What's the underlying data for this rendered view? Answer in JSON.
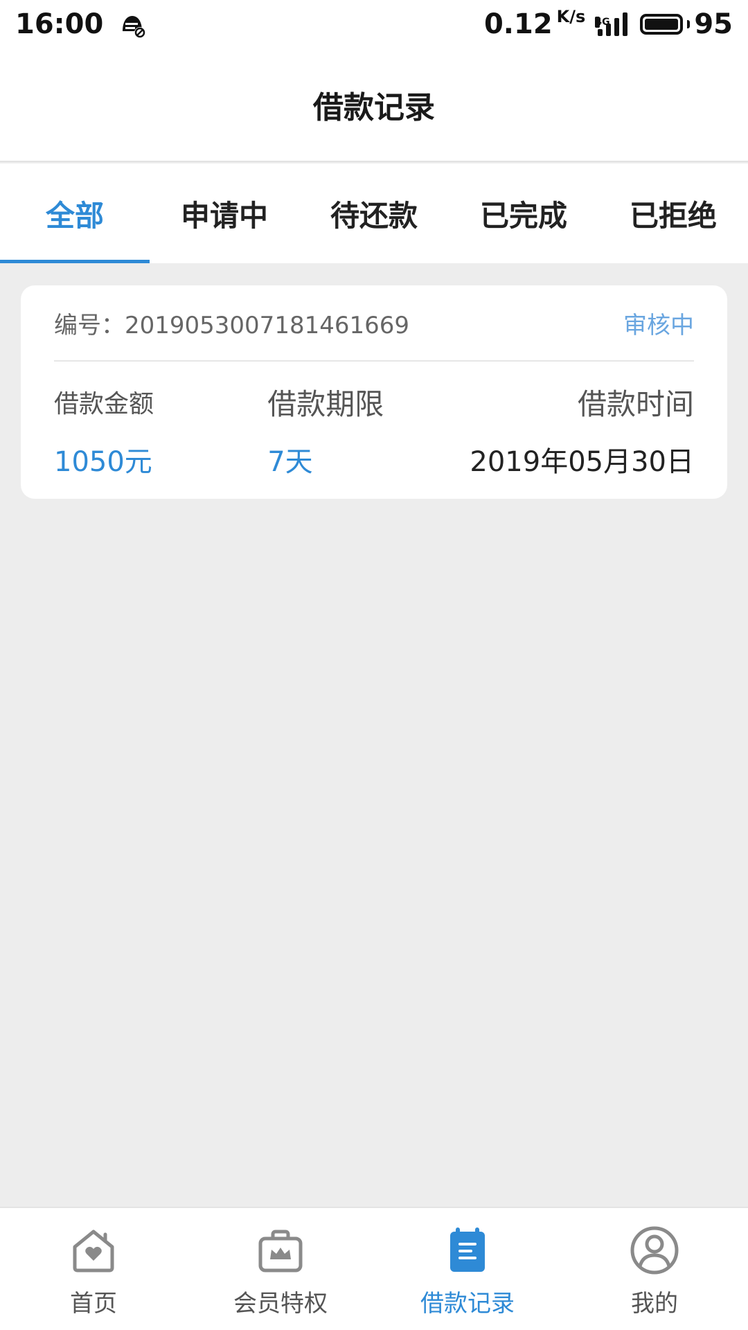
{
  "status_bar": {
    "time": "16:00",
    "speed": "0.12",
    "speed_unit": "K/s",
    "network": "4G",
    "battery": "95"
  },
  "header": {
    "title": "借款记录"
  },
  "tabs": [
    {
      "label": "全部",
      "active": true
    },
    {
      "label": "申请中",
      "active": false
    },
    {
      "label": "待还款",
      "active": false
    },
    {
      "label": "已完成",
      "active": false
    },
    {
      "label": "已拒绝",
      "active": false
    }
  ],
  "record": {
    "number_label": "编号：",
    "number": "201905300718146 1669",
    "status": "审核中",
    "amount_label": "借款金额",
    "amount": "1050元",
    "term_label": "借款期限",
    "term": "7天",
    "time_label": "借款时间",
    "time": "2019年05月30日"
  },
  "bottom_nav": [
    {
      "label": "首页",
      "icon": "home-heart-icon",
      "active": false
    },
    {
      "label": "会员特权",
      "icon": "member-crown-bag-icon",
      "active": false
    },
    {
      "label": "借款记录",
      "icon": "document-list-icon",
      "active": true
    },
    {
      "label": "我的",
      "icon": "user-profile-icon",
      "active": false
    }
  ],
  "colors": {
    "accent": "#2e8ad6",
    "status_text": "#6aa6e0",
    "background": "#ededed"
  }
}
